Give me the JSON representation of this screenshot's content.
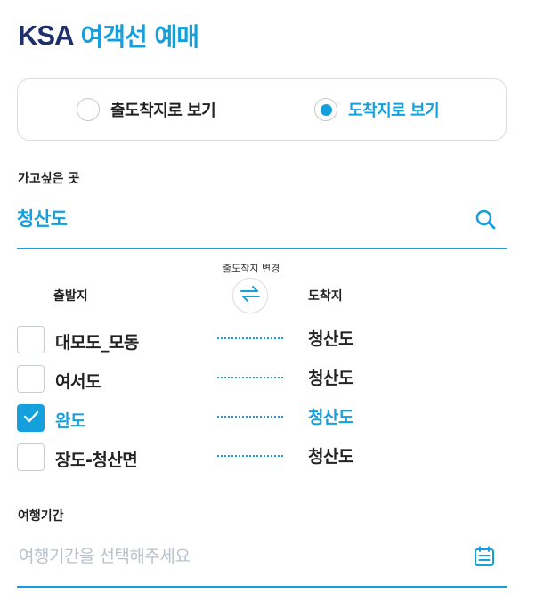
{
  "header": {
    "brand": "KSA",
    "title": "여객선 예매"
  },
  "view_toggle": {
    "options": [
      {
        "label": "출도착지로 보기",
        "selected": false
      },
      {
        "label": "도착지로 보기",
        "selected": true
      }
    ]
  },
  "destination": {
    "label": "가고싶은 곳",
    "value": "청산도",
    "search_icon": "search-icon"
  },
  "routes_header": {
    "depart": "출발지",
    "arrive": "도착지",
    "swap_caption": "출도착지 변경",
    "swap_icon": "swap-arrows-icon"
  },
  "routes": [
    {
      "from": "대모도_모동",
      "to": "청산도",
      "checked": false
    },
    {
      "from": "여서도",
      "to": "청산도",
      "checked": false
    },
    {
      "from": "완도",
      "to": "청산도",
      "checked": true
    },
    {
      "from": "장도-청산면",
      "to": "청산도",
      "checked": false
    }
  ],
  "travel_period": {
    "label": "여행기간",
    "placeholder": "여행기간을 선택해주세요",
    "calendar_icon": "calendar-icon"
  },
  "colors": {
    "accent": "#14a0dc",
    "brand": "#1e2f6e",
    "border": "#d9dde3",
    "placeholder": "#b8c2cc"
  }
}
